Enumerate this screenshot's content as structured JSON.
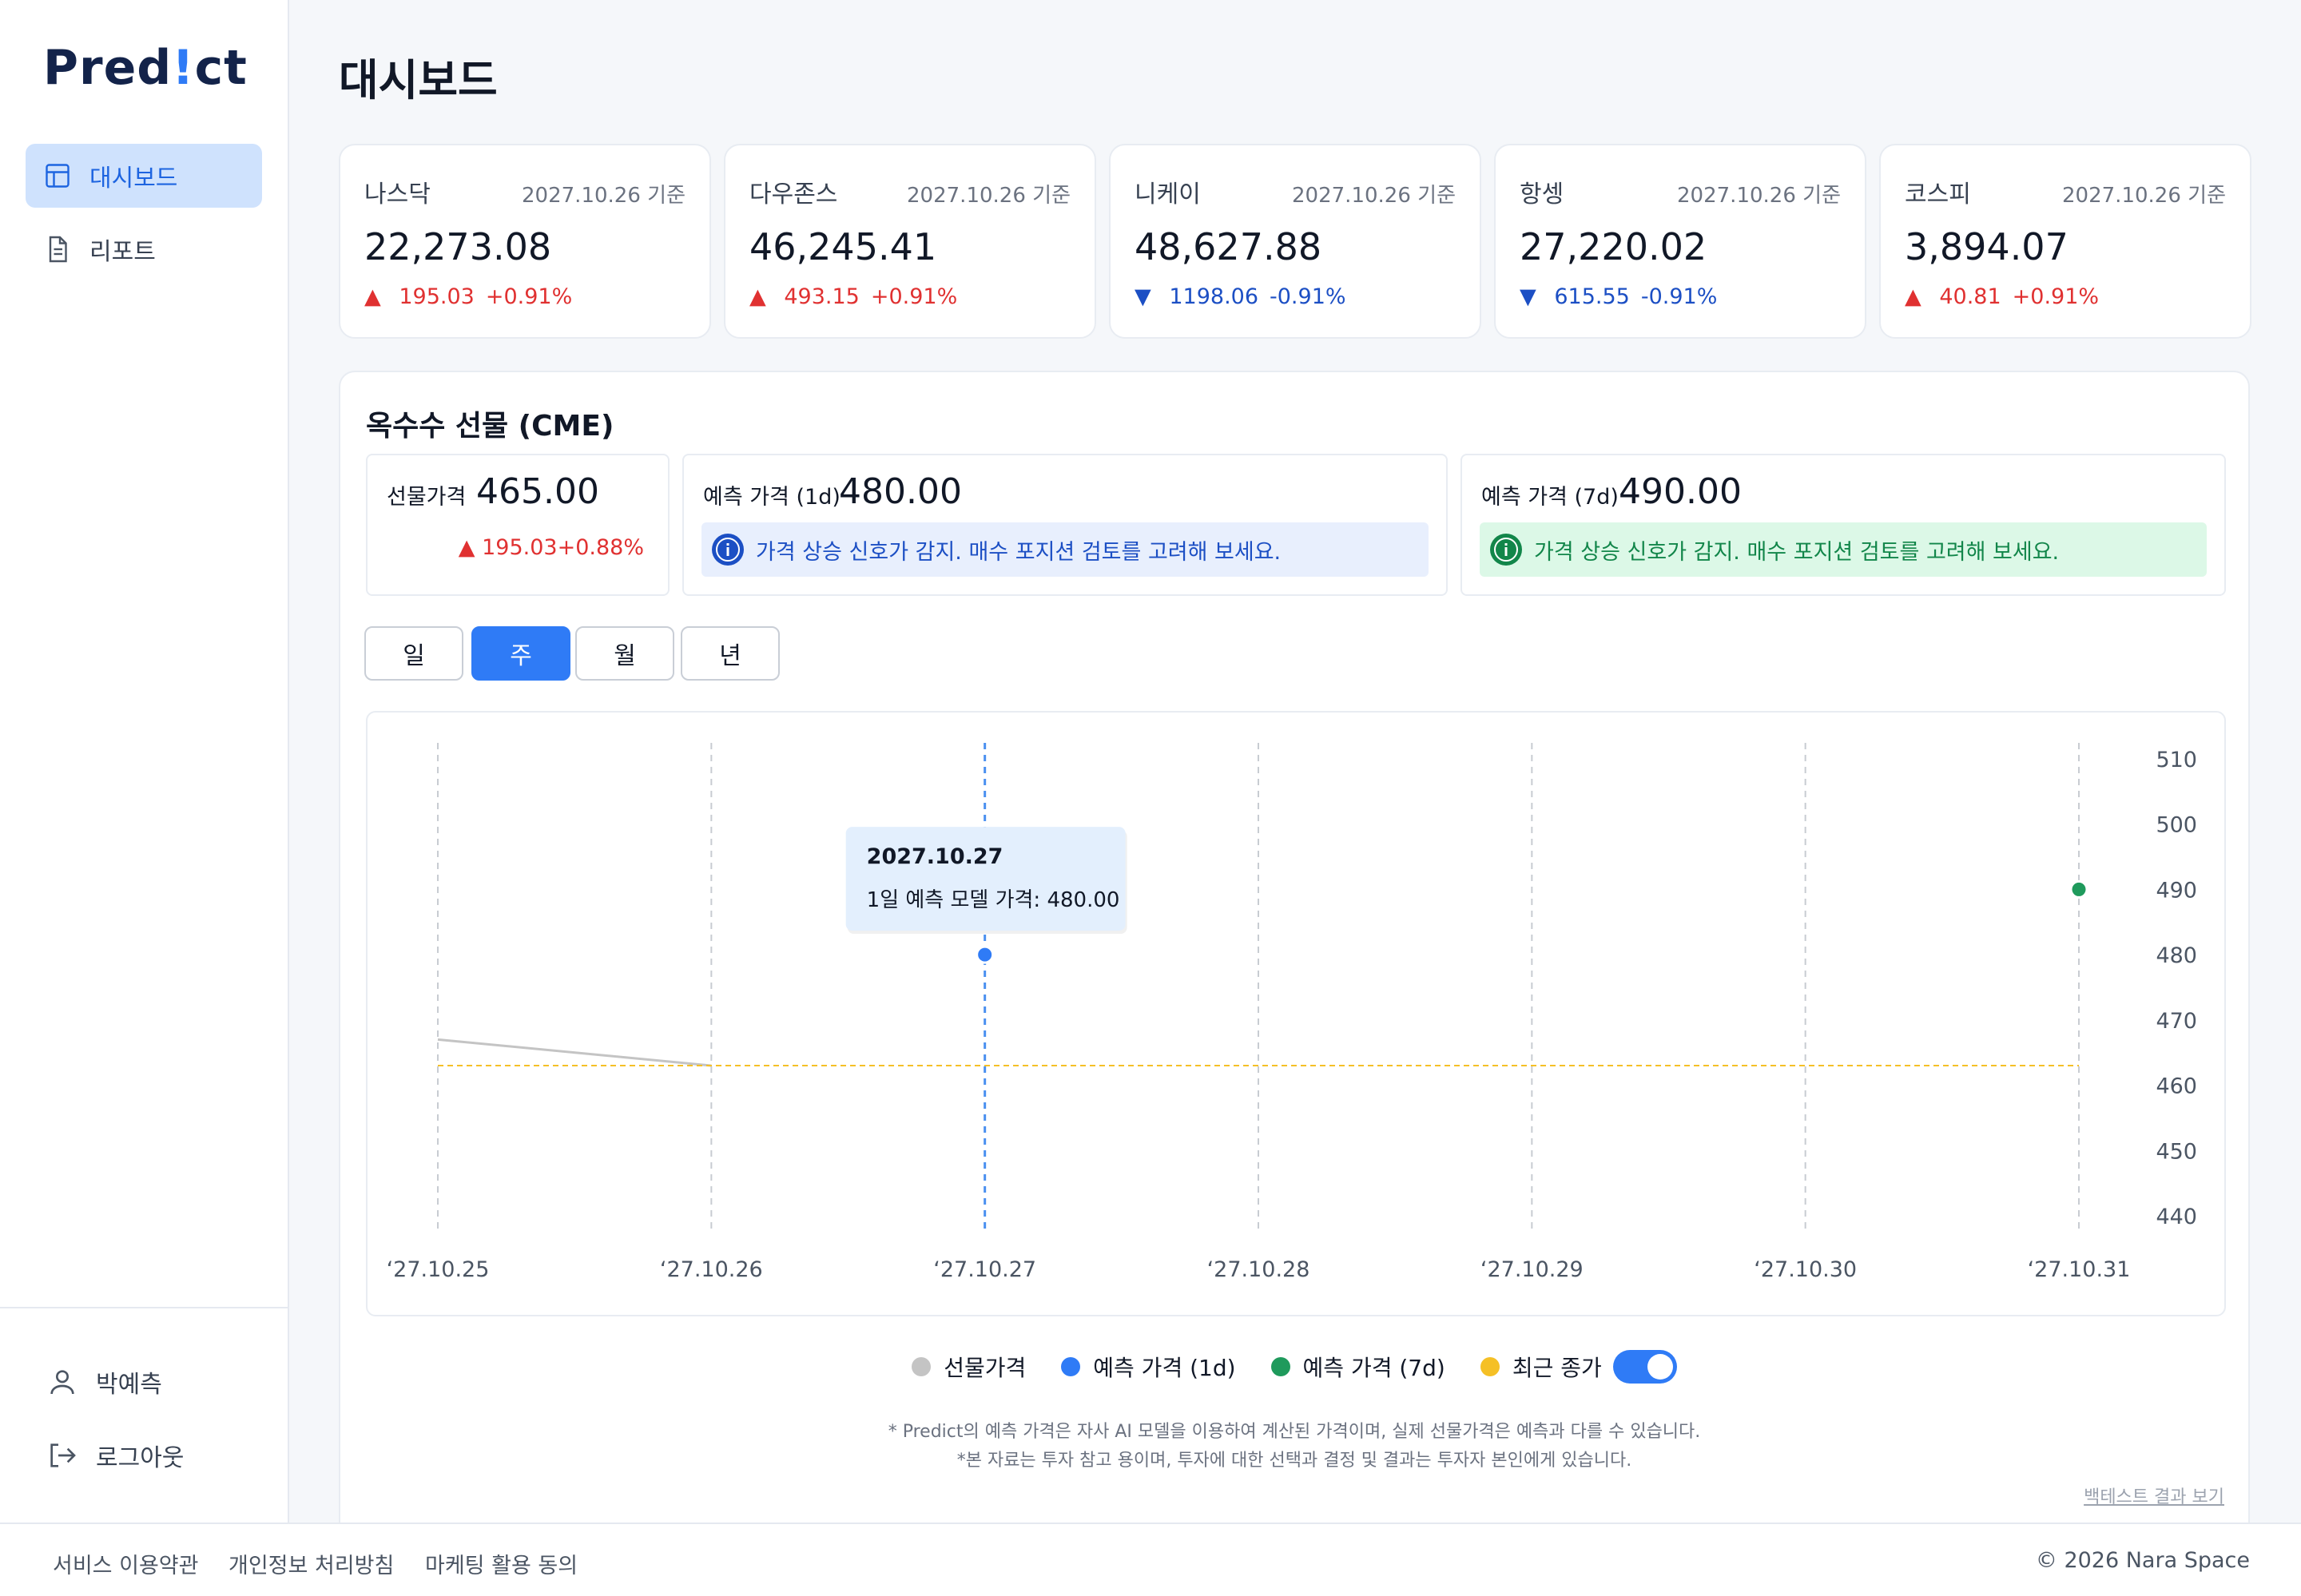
{
  "brand": {
    "logo_pre": "Pred",
    "logo_accent": "!",
    "logo_post": "ct"
  },
  "sidebar": {
    "items": [
      {
        "label": "대시보드",
        "icon": "layout-icon",
        "active": true
      },
      {
        "label": "리포트",
        "icon": "document-icon",
        "active": false
      }
    ],
    "user": {
      "name": "박예측",
      "icon": "user-icon"
    },
    "logout": {
      "label": "로그아웃",
      "icon": "logout-icon"
    }
  },
  "page": {
    "title": "대시보드"
  },
  "indices": [
    {
      "name": "나스닥",
      "date": "2027.10.26 기준",
      "value": "22,273.08",
      "direction": "up",
      "arrow": "▲",
      "change": "195.03",
      "pct": "+0.91%"
    },
    {
      "name": "다우존스",
      "date": "2027.10.26 기준",
      "value": "46,245.41",
      "direction": "up",
      "arrow": "▲",
      "change": "493.15",
      "pct": "+0.91%"
    },
    {
      "name": "니케이",
      "date": "2027.10.26 기준",
      "value": "48,627.88",
      "direction": "down",
      "arrow": "▼",
      "change": "1198.06",
      "pct": "-0.91%"
    },
    {
      "name": "항셍",
      "date": "2027.10.26 기준",
      "value": "27,220.02",
      "direction": "down",
      "arrow": "▼",
      "change": "615.55",
      "pct": "-0.91%"
    },
    {
      "name": "코스피",
      "date": "2027.10.26 기준",
      "value": "3,894.07",
      "direction": "up",
      "arrow": "▲",
      "change": "40.81",
      "pct": "+0.91%"
    }
  ],
  "commodity": {
    "title": "옥수수 선물 (CME)",
    "futures": {
      "label": "선물가격",
      "value": "465.00",
      "change": "▲ 195.03+0.88%"
    },
    "forecast_1d": {
      "label": "예측 가격 (1d)",
      "value": "480.00",
      "signal": "가격 상승 신호가 감지. 매수 포지션 검토를 고려해 보세요."
    },
    "forecast_7d": {
      "label": "예측 가격 (7d)",
      "value": "490.00",
      "signal": "가격 상승 신호가 감지. 매수 포지션 검토를 고려해 보세요."
    }
  },
  "periods": [
    {
      "label": "일",
      "active": false
    },
    {
      "label": "주",
      "active": true
    },
    {
      "label": "월",
      "active": false
    },
    {
      "label": "년",
      "active": false
    }
  ],
  "tooltip": {
    "date": "2027.10.27",
    "text": "1일 예측 모델 가격: 480.00"
  },
  "chart_data": {
    "type": "line",
    "x": [
      "2027-10-25",
      "2027-10-26",
      "2027-10-27",
      "2027-10-28",
      "2027-10-29",
      "2027-10-30",
      "2027-10-31"
    ],
    "x_tick_labels": [
      "‘27.10.25",
      "‘27.10.26",
      "‘27.10.27",
      "‘27.10.28",
      "‘27.10.29",
      "‘27.10.30",
      "‘27.10.31"
    ],
    "y_ticks": [
      510,
      500,
      490,
      480,
      470,
      460,
      450,
      440
    ],
    "ylim": [
      440,
      510
    ],
    "y_axis_side": "right",
    "grid": "vertical dashed",
    "series": [
      {
        "name": "선물가격",
        "color": "#c4c4c4",
        "points": [
          {
            "x": "2027-10-25",
            "y": 467
          },
          {
            "x": "2027-10-26",
            "y": 463
          }
        ]
      },
      {
        "name": "예측 가격 (1d)",
        "color": "#2f7bf6",
        "points": [
          {
            "x": "2027-10-27",
            "y": 480
          }
        ]
      },
      {
        "name": "예측 가격 (7d)",
        "color": "#1f9a5c",
        "points": [
          {
            "x": "2027-10-31",
            "y": 490
          }
        ]
      },
      {
        "name": "최근 종가",
        "color": "#f5c026",
        "style": "dashed",
        "points": [
          {
            "x": "2027-10-25",
            "y": 463
          },
          {
            "x": "2027-10-31",
            "y": 463
          }
        ]
      }
    ],
    "highlight_x": "2027-10-27"
  },
  "legend": {
    "items": [
      {
        "label": "선물가격",
        "color": "#c4c4c4"
      },
      {
        "label": "예측 가격 (1d)",
        "color": "#2f7bf6"
      },
      {
        "label": "예측 가격 (7d)",
        "color": "#1f9a5c"
      },
      {
        "label": "최근 종가",
        "color": "#f5c026"
      }
    ],
    "toggle_on": true
  },
  "disclaimers": {
    "line1": "* Predict의 예측 가격은 자사 AI 모델을 이용하여 계산된 가격이며, 실제 선물가격은 예측과 다를 수 있습니다.",
    "line2": "*본 자료는 투자 참고 용이며, 투자에 대한 선택과 결정 및 결과는 투자자 본인에게 있습니다."
  },
  "backtest_link": "백테스트 결과 보기",
  "footer": {
    "links": [
      "서비스 이용약관",
      "개인정보 처리방침",
      "마케팅 활용 동의"
    ],
    "copyright": "© 2026 Nara Space"
  }
}
